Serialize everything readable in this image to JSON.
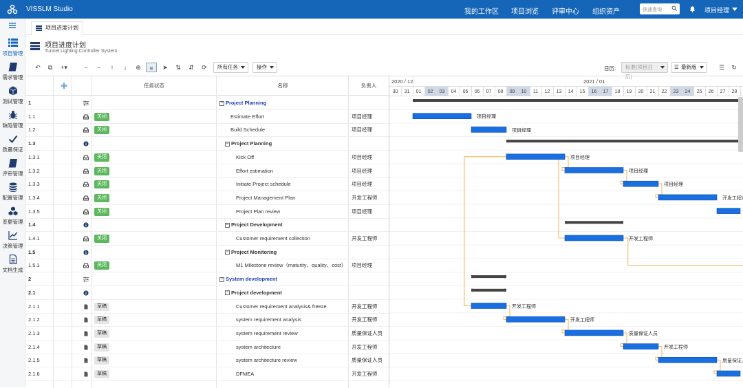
{
  "app": {
    "title": "VISSLM Studio"
  },
  "topnav": {
    "items": [
      "我的工作区",
      "项目浏览",
      "评审中心",
      "组织资产"
    ],
    "search_placeholder": "快速查询",
    "user": "项目经理"
  },
  "sidebar": {
    "items": [
      "项目管理",
      "需求管理",
      "测试管理",
      "缺陷管理",
      "质量保证",
      "评审管理",
      "配置管理",
      "变更管理",
      "决策管理",
      "文档生成"
    ]
  },
  "tabs": [
    "项目进度计划"
  ],
  "page": {
    "title": "项目进度计划",
    "subtitle": "Tunnel Lighting Controller System"
  },
  "toolbar": {
    "filter": "所有任务",
    "ops": "操作",
    "calendar_label": "日历:",
    "calendar_value": "标准(项目日历)",
    "version": "最新版"
  },
  "grid": {
    "headers": {
      "status": "任务状态",
      "name": "名称",
      "owner": "负责人"
    },
    "rows": [
      {
        "id": "1",
        "icon": "sliders",
        "status": "",
        "name": "Project Planning",
        "owner": "",
        "level": 1,
        "group": true
      },
      {
        "id": "1.1",
        "icon": "inbox",
        "status": "关闭",
        "name": "Estimate Effort",
        "owner": "项目经理",
        "level": 2,
        "group": false
      },
      {
        "id": "1.2",
        "icon": "inbox",
        "status": "关闭",
        "name": "Build Schedule",
        "owner": "项目经理",
        "level": 2,
        "group": false
      },
      {
        "id": "1.3",
        "icon": "info",
        "status": "",
        "name": "Project Planning",
        "owner": "",
        "level": 2,
        "group": true
      },
      {
        "id": "1.3.1",
        "icon": "inbox",
        "status": "关闭",
        "name": "Kick Off",
        "owner": "项目经理",
        "level": 3,
        "group": false
      },
      {
        "id": "1.3.2",
        "icon": "inbox",
        "status": "关闭",
        "name": "Effort estimation",
        "owner": "项目经理",
        "level": 3,
        "group": false
      },
      {
        "id": "1.3.3",
        "icon": "inbox",
        "status": "关闭",
        "name": "Initiate Project schedule",
        "owner": "项目经理",
        "level": 3,
        "group": false
      },
      {
        "id": "1.3.4",
        "icon": "inbox",
        "status": "关闭",
        "name": "Project Management Plan",
        "owner": "开发工程师",
        "level": 3,
        "group": false
      },
      {
        "id": "1.3.5",
        "icon": "inbox",
        "status": "关闭",
        "name": "Project Plan review",
        "owner": "项目经理",
        "level": 3,
        "group": false
      },
      {
        "id": "1.4",
        "icon": "info",
        "status": "",
        "name": "Project Development",
        "owner": "",
        "level": 2,
        "group": true
      },
      {
        "id": "1.4.1",
        "icon": "inbox",
        "status": "关闭",
        "name": "Customer requirement collection",
        "owner": "开发工程师",
        "level": 3,
        "group": false
      },
      {
        "id": "1.5",
        "icon": "info",
        "status": "",
        "name": "Project Monitoring",
        "owner": "",
        "level": 2,
        "group": true
      },
      {
        "id": "1.5.1",
        "icon": "inbox",
        "status": "关闭",
        "name": "M1 Milestone review（maturity、quality、cost）",
        "owner": "项目经理",
        "level": 3,
        "group": false
      },
      {
        "id": "2",
        "icon": "sliders",
        "status": "",
        "name": "System development",
        "owner": "",
        "level": 1,
        "group": true
      },
      {
        "id": "2.1",
        "icon": "info",
        "status": "",
        "name": "Project development",
        "owner": "",
        "level": 2,
        "group": true
      },
      {
        "id": "2.1.1",
        "icon": "doc",
        "status": "草稿",
        "name": "Customer requirement analysis& freeze",
        "owner": "开发工程师",
        "level": 3,
        "group": false
      },
      {
        "id": "2.1.2",
        "icon": "doc",
        "status": "草稿",
        "name": "system requirement analysis",
        "owner": "开发工程师",
        "level": 3,
        "group": false
      },
      {
        "id": "2.1.3",
        "icon": "doc",
        "status": "草稿",
        "name": "system requirement review",
        "owner": "质量保证人员",
        "level": 3,
        "group": false
      },
      {
        "id": "2.1.4",
        "icon": "doc",
        "status": "草稿",
        "name": "system architecture",
        "owner": "开发工程师",
        "level": 3,
        "group": false
      },
      {
        "id": "2.1.5",
        "icon": "doc",
        "status": "草稿",
        "name": "system architecture review",
        "owner": "质量保证人员",
        "level": 3,
        "group": false
      },
      {
        "id": "2.1.6",
        "icon": "doc",
        "status": "草稿",
        "name": "DFMEA",
        "owner": "开发工程师",
        "level": 3,
        "group": false
      }
    ]
  },
  "gantt": {
    "months": [
      {
        "label": "2020 / 12",
        "start": 0
      },
      {
        "label": "2021 / 01",
        "start": 2
      }
    ],
    "days": [
      "30",
      "31",
      "01",
      "02",
      "03",
      "04",
      "05",
      "06",
      "07",
      "08",
      "09",
      "10",
      "11",
      "12",
      "13",
      "14",
      "15",
      "16",
      "17",
      "18",
      "19",
      "20",
      "21",
      "22",
      "23",
      "24",
      "25",
      "26",
      "27",
      "28"
    ],
    "weekend": [
      3,
      4,
      10,
      11,
      17,
      18,
      24,
      25
    ],
    "bars": [
      {
        "row": 0,
        "start": 2,
        "end": 30,
        "type": "summary"
      },
      {
        "row": 1,
        "start": 2,
        "end": 7,
        "type": "task",
        "label": "项目经理"
      },
      {
        "row": 2,
        "start": 7,
        "end": 10,
        "type": "task",
        "label": "项目经理"
      },
      {
        "row": 3,
        "start": 10,
        "end": 30,
        "type": "summary"
      },
      {
        "row": 4,
        "start": 10,
        "end": 15,
        "type": "task",
        "label": "项目经理"
      },
      {
        "row": 5,
        "start": 15,
        "end": 20,
        "type": "task",
        "label": "项目经理"
      },
      {
        "row": 6,
        "start": 20,
        "end": 23,
        "type": "task",
        "label": "项目经理"
      },
      {
        "row": 7,
        "start": 23,
        "end": 28,
        "type": "task",
        "label": "开发工程师"
      },
      {
        "row": 8,
        "start": 28,
        "end": 30,
        "type": "task",
        "label": ""
      },
      {
        "row": 9,
        "start": 15,
        "end": 20,
        "type": "summary"
      },
      {
        "row": 10,
        "start": 15,
        "end": 20,
        "type": "task",
        "label": "开发工程师"
      },
      {
        "row": 13,
        "start": 7,
        "end": 10,
        "type": "summary"
      },
      {
        "row": 14,
        "start": 7,
        "end": 10,
        "type": "summary"
      },
      {
        "row": 15,
        "start": 7,
        "end": 10,
        "type": "task",
        "label": "开发工程师"
      },
      {
        "row": 16,
        "start": 10,
        "end": 15,
        "type": "task",
        "label": "开发工程师"
      },
      {
        "row": 17,
        "start": 15,
        "end": 20,
        "type": "task",
        "label": "质量保证人员"
      },
      {
        "row": 18,
        "start": 20,
        "end": 23,
        "type": "task",
        "label": "开发工程师"
      },
      {
        "row": 19,
        "start": 23,
        "end": 28,
        "type": "task",
        "label": "质量保证人员"
      },
      {
        "row": 20,
        "start": 28,
        "end": 30,
        "type": "task",
        "label": ""
      }
    ],
    "links": [
      [
        4,
        5
      ],
      [
        5,
        6
      ],
      [
        6,
        7
      ],
      [
        15,
        16
      ],
      [
        16,
        17
      ],
      [
        17,
        18
      ],
      [
        18,
        19
      ],
      [
        19,
        20
      ],
      [
        10,
        12
      ]
    ],
    "colors": {
      "task": "#1a6fe0",
      "summary": "#444444",
      "link": "#f0a030"
    }
  }
}
